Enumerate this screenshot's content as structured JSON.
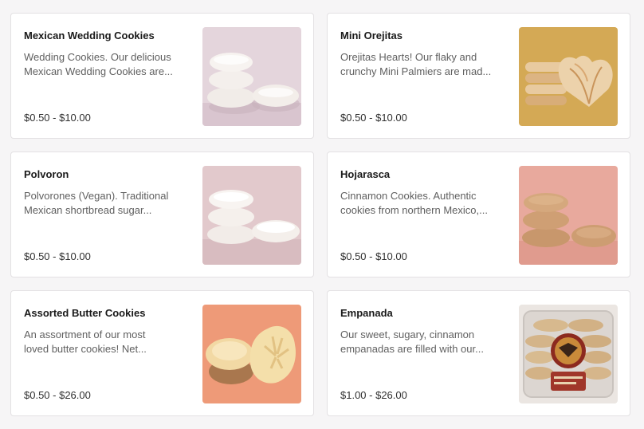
{
  "products": [
    {
      "name": "Mexican Wedding Cookies",
      "description_line1": "Wedding Cookies. Our delicious",
      "description_line2": "Mexican Wedding Cookies are...",
      "price": "$0.50 - $10.00",
      "image": "mexican-wedding-cookies-photo",
      "image_bg": "#e4d5dc"
    },
    {
      "name": "Mini Orejitas",
      "description_line1": "Orejitas Hearts! Our flaky and",
      "description_line2": "crunchy Mini Palmiers are mad...",
      "price": "$0.50 - $10.00",
      "image": "mini-orejitas-photo",
      "image_bg": "#d4a955"
    },
    {
      "name": "Polvoron",
      "description_line1": "Polvorones (Vegan). Traditional",
      "description_line2": "Mexican shortbread sugar...",
      "price": "$0.50 - $10.00",
      "image": "polvoron-photo",
      "image_bg": "#e2c9cc"
    },
    {
      "name": "Hojarasca",
      "description_line1": "Cinnamon Cookies. Authentic",
      "description_line2": "cookies from northern Mexico,...",
      "price": "$0.50 - $10.00",
      "image": "hojarasca-photo",
      "image_bg": "#e8a99d"
    },
    {
      "name": "Assorted Butter Cookies",
      "description_line1": "An assortment of our most",
      "description_line2": "loved butter cookies! Net...",
      "price": "$0.50 - $26.00",
      "image": "assorted-butter-cookies-photo",
      "image_bg": "#ee9a78"
    },
    {
      "name": "Empanada",
      "description_line1": "Our sweet, sugary, cinnamon",
      "description_line2": "empanadas are filled with our...",
      "price": "$1.00 - $26.00",
      "image": "empanada-package-photo",
      "image_bg": "#ebe6e2"
    }
  ]
}
